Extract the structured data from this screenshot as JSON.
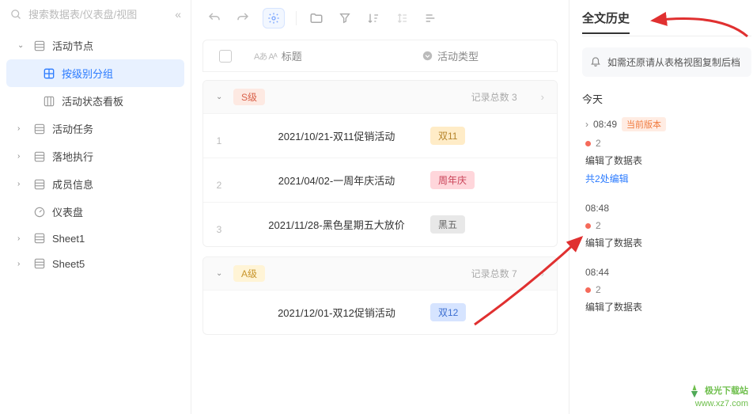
{
  "search": {
    "placeholder": "搜索数据表/仪表盘/视图"
  },
  "sidebar": {
    "items": [
      {
        "label": "活动节点",
        "expanded": true,
        "children": [
          {
            "label": "按级别分组",
            "active": true
          },
          {
            "label": "活动状态看板"
          }
        ]
      },
      {
        "label": "活动任务"
      },
      {
        "label": "落地执行"
      },
      {
        "label": "成员信息"
      },
      {
        "label": "仪表盘"
      },
      {
        "label": "Sheet1"
      },
      {
        "label": "Sheet5"
      }
    ]
  },
  "table": {
    "headers": {
      "title": "标题",
      "type": "活动类型"
    },
    "groups": [
      {
        "badge": "S级",
        "badgeClass": "badge-s",
        "count_label": "记录总数 3",
        "rows": [
          {
            "num": "1",
            "title": "2021/10/21-双11促销活动",
            "tag": "双11",
            "tagClass": "tag-orange"
          },
          {
            "num": "2",
            "title": "2021/04/02-一周年庆活动",
            "tag": "周年庆",
            "tagClass": "tag-red"
          },
          {
            "num": "3",
            "title": "2021/11/28-黑色星期五大放价",
            "tag": "黑五",
            "tagClass": "tag-gray"
          }
        ]
      },
      {
        "badge": "A级",
        "badgeClass": "badge-a",
        "count_label": "记录总数 7",
        "rows": [
          {
            "num": "",
            "title": "2021/12/01-双12促销活动",
            "tag": "双12",
            "tagClass": "tag-blue"
          }
        ]
      }
    ]
  },
  "history": {
    "title": "全文历史",
    "notice": "如需还原请从表格视图复制后档",
    "today": "今天",
    "items": [
      {
        "time": "08:49",
        "current": true,
        "current_label": "当前版本",
        "count": "2",
        "desc": "编辑了数据表",
        "link": "共2处编辑"
      },
      {
        "time": "08:48",
        "count": "2",
        "desc": "编辑了数据表"
      },
      {
        "time": "08:44",
        "count": "2",
        "desc": "编辑了数据表"
      }
    ]
  },
  "watermark": {
    "cn": "极光下载站",
    "url": "www.xz7.com"
  }
}
